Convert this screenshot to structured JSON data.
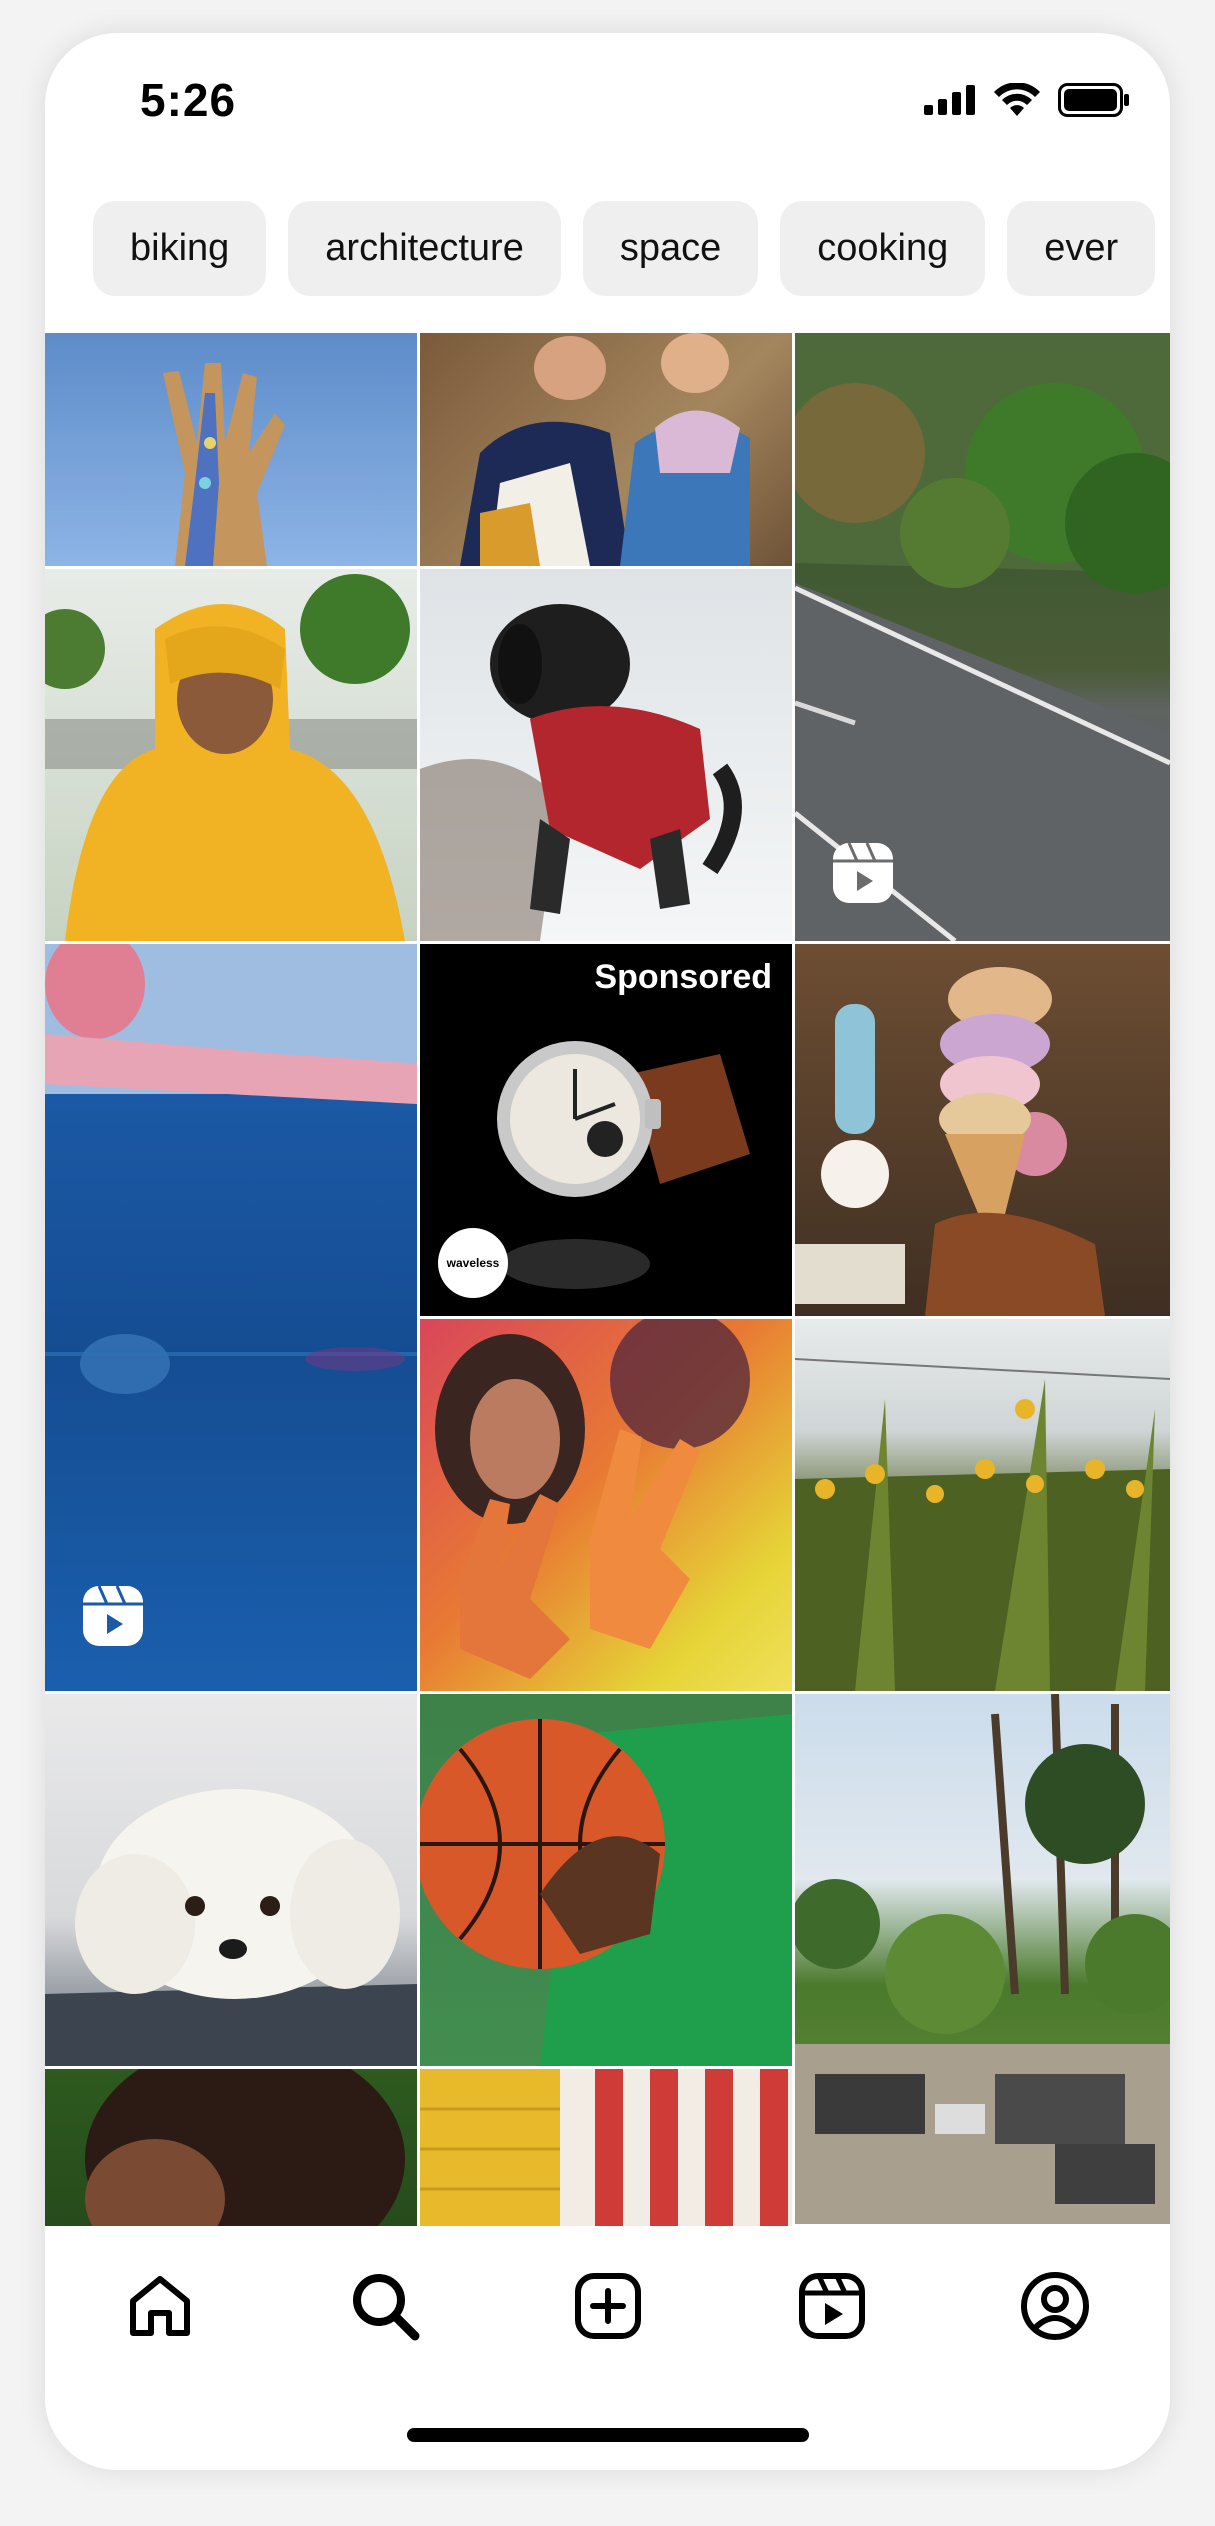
{
  "status_bar": {
    "time": "5:26"
  },
  "chips": [
    "biking",
    "architecture",
    "space",
    "cooking",
    "ever"
  ],
  "grid": {
    "sponsored_label": "Sponsored",
    "sponsor_brand": "waveless"
  },
  "tab_bar": {
    "items": [
      {
        "icon": "home-icon"
      },
      {
        "icon": "search-icon",
        "active": true
      },
      {
        "icon": "create-icon"
      },
      {
        "icon": "reels-icon"
      },
      {
        "icon": "profile-icon"
      }
    ]
  },
  "colors": {
    "chip_bg": "#efefef",
    "text": "#111111",
    "background": "#ffffff"
  }
}
